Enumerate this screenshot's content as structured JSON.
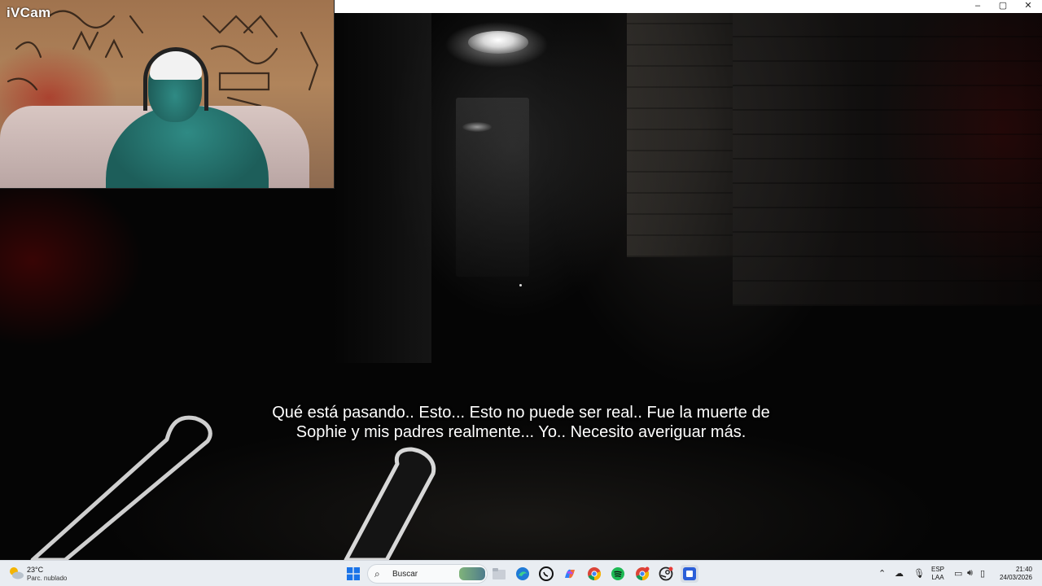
{
  "webcam": {
    "label": "iVCam"
  },
  "game": {
    "subtitle_line1": "Qué está pasando.. Esto... Esto no puede ser real.. Fue la muerte de",
    "subtitle_line2": "Sophie y mis padres realmente... Yo.. Necesito averiguar más."
  },
  "window": {
    "minimize": "–",
    "maximize": "▢",
    "close": "✕"
  },
  "taskbar": {
    "weather": {
      "temp": "23°C",
      "desc": "Parc. nublado",
      "icon": "partly-cloudy-icon"
    },
    "search_label": "Buscar",
    "pinned_apps": [
      {
        "name": "start-button",
        "icon": "windows-logo-icon"
      },
      {
        "name": "file-explorer",
        "icon": "folder-icon"
      },
      {
        "name": "edge",
        "icon": "edge-icon"
      },
      {
        "name": "whatsapp",
        "icon": "whatsapp-icon"
      },
      {
        "name": "copilot",
        "icon": "copilot-icon"
      },
      {
        "name": "chrome",
        "icon": "chrome-icon"
      },
      {
        "name": "spotify",
        "icon": "spotify-icon"
      },
      {
        "name": "chrome-profile",
        "icon": "chrome-icon"
      },
      {
        "name": "steam",
        "icon": "steam-icon"
      },
      {
        "name": "game-app",
        "icon": "app-icon"
      }
    ],
    "tray": {
      "lang_top": "ESP",
      "lang_bottom": "LAA",
      "time": "21:40",
      "date": "24/03/2026"
    }
  }
}
